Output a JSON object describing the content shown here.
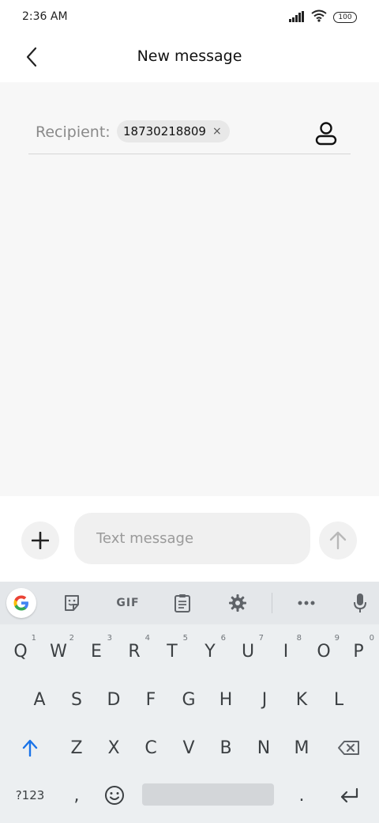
{
  "status": {
    "time": "2:36 AM",
    "battery": "100"
  },
  "header": {
    "title": "New message"
  },
  "recipient": {
    "label": "Recipient:",
    "chip": "18730218809",
    "chip_remove": "×"
  },
  "compose": {
    "placeholder": "Text message"
  },
  "keyboard": {
    "toolbar": {
      "gif": "GIF"
    },
    "row1": [
      {
        "key": "Q",
        "hint": "1"
      },
      {
        "key": "W",
        "hint": "2"
      },
      {
        "key": "E",
        "hint": "3"
      },
      {
        "key": "R",
        "hint": "4"
      },
      {
        "key": "T",
        "hint": "5"
      },
      {
        "key": "Y",
        "hint": "6"
      },
      {
        "key": "U",
        "hint": "7"
      },
      {
        "key": "I",
        "hint": "8"
      },
      {
        "key": "O",
        "hint": "9"
      },
      {
        "key": "P",
        "hint": "0"
      }
    ],
    "row2": [
      "A",
      "S",
      "D",
      "F",
      "G",
      "H",
      "J",
      "K",
      "L"
    ],
    "row3": [
      "Z",
      "X",
      "C",
      "V",
      "B",
      "N",
      "M"
    ],
    "row4": {
      "symbols": "?123",
      "comma": ",",
      "period": "."
    }
  },
  "colors": {
    "shift_accent": "#1a73e8",
    "keyboard_bg": "#eceff1"
  }
}
